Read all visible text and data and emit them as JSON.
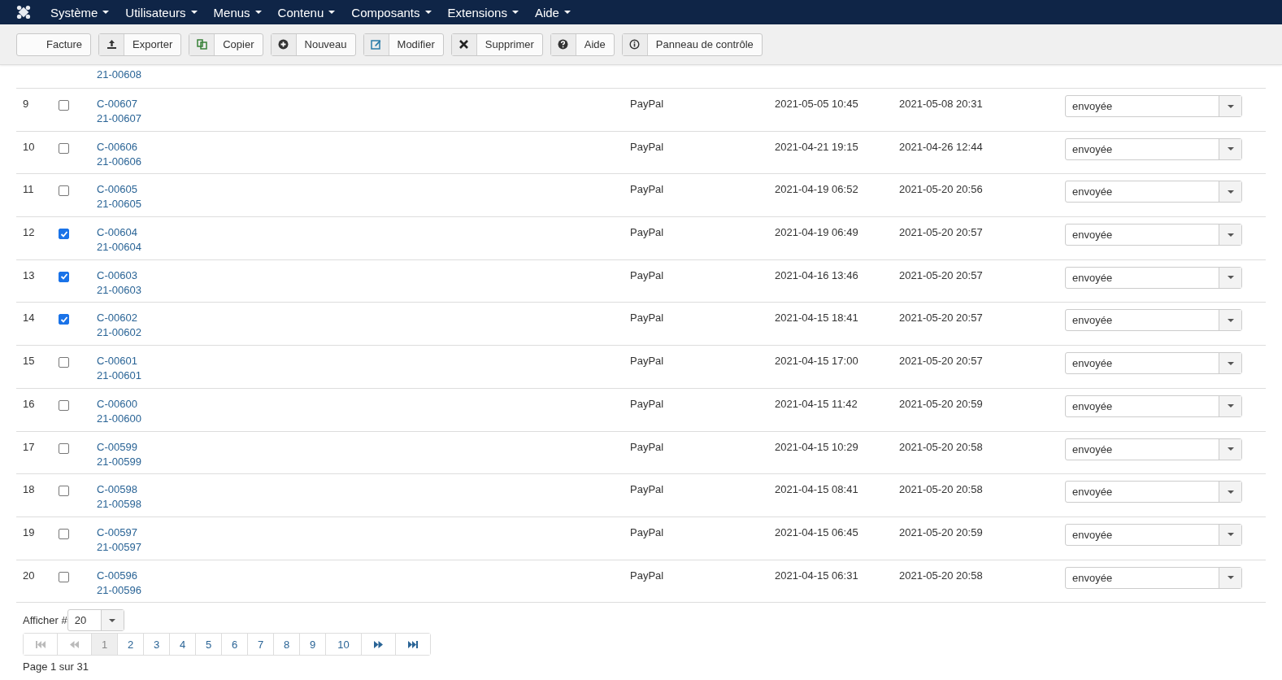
{
  "menu": [
    {
      "label": "Système"
    },
    {
      "label": "Utilisateurs"
    },
    {
      "label": "Menus"
    },
    {
      "label": "Contenu"
    },
    {
      "label": "Composants"
    },
    {
      "label": "Extensions"
    },
    {
      "label": "Aide"
    }
  ],
  "toolbar": [
    {
      "kind": "none",
      "label": "Facture"
    },
    {
      "kind": "export",
      "label": "Exporter"
    },
    {
      "kind": "copy",
      "label": "Copier"
    },
    {
      "kind": "new",
      "label": "Nouveau"
    },
    {
      "kind": "edit",
      "label": "Modifier"
    },
    {
      "kind": "delete",
      "label": "Supprimer"
    },
    {
      "kind": "help",
      "label": "Aide"
    },
    {
      "kind": "info",
      "label": "Panneau de contrôle"
    }
  ],
  "partial_row": {
    "ref2": "21-00608"
  },
  "rows": [
    {
      "num": "9",
      "checked": false,
      "ref1": "C-00607",
      "ref2": "21-00607",
      "payment": "PayPal",
      "date1": "2021-05-05 10:45",
      "date2": "2021-05-08 20:31",
      "status": "envoyée"
    },
    {
      "num": "10",
      "checked": false,
      "ref1": "C-00606",
      "ref2": "21-00606",
      "payment": "PayPal",
      "date1": "2021-04-21 19:15",
      "date2": "2021-04-26 12:44",
      "status": "envoyée"
    },
    {
      "num": "11",
      "checked": false,
      "ref1": "C-00605",
      "ref2": "21-00605",
      "payment": "PayPal",
      "date1": "2021-04-19 06:52",
      "date2": "2021-05-20 20:56",
      "status": "envoyée"
    },
    {
      "num": "12",
      "checked": true,
      "ref1": "C-00604",
      "ref2": "21-00604",
      "payment": "PayPal",
      "date1": "2021-04-19 06:49",
      "date2": "2021-05-20 20:57",
      "status": "envoyée"
    },
    {
      "num": "13",
      "checked": true,
      "ref1": "C-00603",
      "ref2": "21-00603",
      "payment": "PayPal",
      "date1": "2021-04-16 13:46",
      "date2": "2021-05-20 20:57",
      "status": "envoyée"
    },
    {
      "num": "14",
      "checked": true,
      "ref1": "C-00602",
      "ref2": "21-00602",
      "payment": "PayPal",
      "date1": "2021-04-15 18:41",
      "date2": "2021-05-20 20:57",
      "status": "envoyée"
    },
    {
      "num": "15",
      "checked": false,
      "ref1": "C-00601",
      "ref2": "21-00601",
      "payment": "PayPal",
      "date1": "2021-04-15 17:00",
      "date2": "2021-05-20 20:57",
      "status": "envoyée"
    },
    {
      "num": "16",
      "checked": false,
      "ref1": "C-00600",
      "ref2": "21-00600",
      "payment": "PayPal",
      "date1": "2021-04-15 11:42",
      "date2": "2021-05-20 20:59",
      "status": "envoyée"
    },
    {
      "num": "17",
      "checked": false,
      "ref1": "C-00599",
      "ref2": "21-00599",
      "payment": "PayPal",
      "date1": "2021-04-15 10:29",
      "date2": "2021-05-20 20:58",
      "status": "envoyée"
    },
    {
      "num": "18",
      "checked": false,
      "ref1": "C-00598",
      "ref2": "21-00598",
      "payment": "PayPal",
      "date1": "2021-04-15 08:41",
      "date2": "2021-05-20 20:58",
      "status": "envoyée"
    },
    {
      "num": "19",
      "checked": false,
      "ref1": "C-00597",
      "ref2": "21-00597",
      "payment": "PayPal",
      "date1": "2021-04-15 06:45",
      "date2": "2021-05-20 20:59",
      "status": "envoyée"
    },
    {
      "num": "20",
      "checked": false,
      "ref1": "C-00596",
      "ref2": "21-00596",
      "payment": "PayPal",
      "date1": "2021-04-15 06:31",
      "date2": "2021-05-20 20:58",
      "status": "envoyée"
    }
  ],
  "limit": {
    "label": "Afficher #",
    "value": "20"
  },
  "pagination": [
    {
      "kind": "first",
      "disabled": true,
      "selected": false
    },
    {
      "kind": "prev",
      "disabled": true,
      "selected": false
    },
    {
      "kind": "page",
      "label": "1",
      "disabled": false,
      "selected": true
    },
    {
      "kind": "page",
      "label": "2",
      "disabled": false,
      "selected": false
    },
    {
      "kind": "page",
      "label": "3",
      "disabled": false,
      "selected": false
    },
    {
      "kind": "page",
      "label": "4",
      "disabled": false,
      "selected": false
    },
    {
      "kind": "page",
      "label": "5",
      "disabled": false,
      "selected": false
    },
    {
      "kind": "page",
      "label": "6",
      "disabled": false,
      "selected": false
    },
    {
      "kind": "page",
      "label": "7",
      "disabled": false,
      "selected": false
    },
    {
      "kind": "page",
      "label": "8",
      "disabled": false,
      "selected": false
    },
    {
      "kind": "page",
      "label": "9",
      "disabled": false,
      "selected": false
    },
    {
      "kind": "page",
      "label": "10",
      "disabled": false,
      "selected": false
    },
    {
      "kind": "next",
      "disabled": false,
      "selected": false
    },
    {
      "kind": "last",
      "disabled": false,
      "selected": false
    }
  ],
  "page_info": "Page 1 sur 31"
}
